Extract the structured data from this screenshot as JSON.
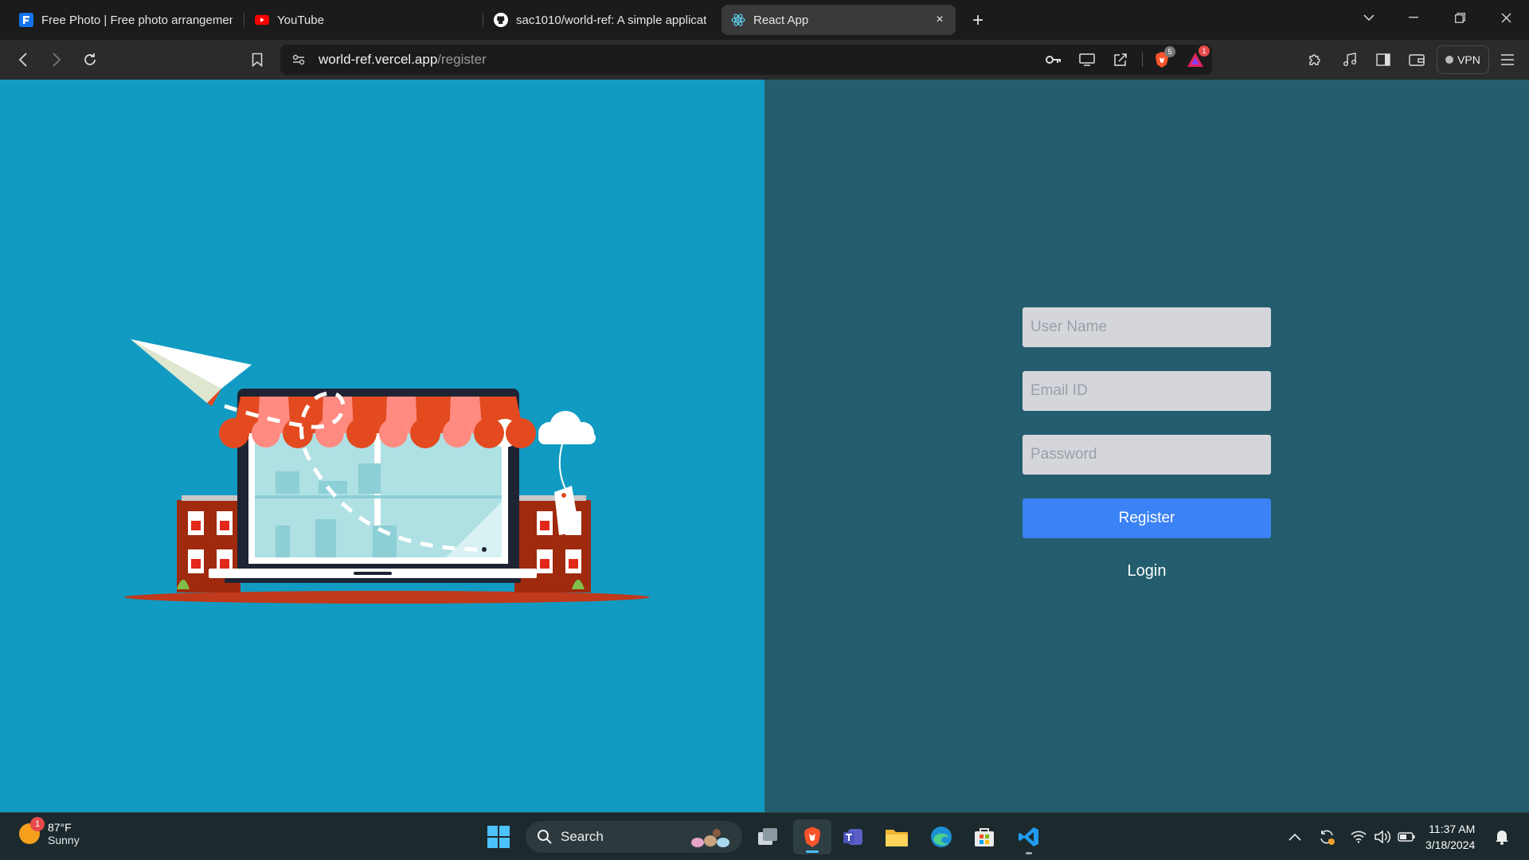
{
  "browser": {
    "tabs": [
      {
        "title": "Free Photo | Free photo arrangemen",
        "favicon": "freepik-icon"
      },
      {
        "title": "YouTube",
        "favicon": "youtube-icon"
      },
      {
        "title": "sac1010/world-ref: A simple applicat",
        "favicon": "github-icon"
      },
      {
        "title": "React App",
        "favicon": "react-icon",
        "active": true
      }
    ],
    "new_tab": "+",
    "url_host": "world-ref.vercel.app",
    "url_path": "/register",
    "brave_shield_count": "5",
    "rewards_count": "1",
    "vpn_label": "VPN",
    "close_tab": "×"
  },
  "form": {
    "username_placeholder": "User Name",
    "email_placeholder": "Email ID",
    "password_placeholder": "Password",
    "register_label": "Register",
    "login_label": "Login"
  },
  "colors": {
    "left_bg": "#129bc2",
    "right_bg": "#235d6e",
    "button": "#3b82f6",
    "field_bg": "#d5d6db"
  },
  "taskbar": {
    "weather_temp": "87°F",
    "weather_desc": "Sunny",
    "weather_badge": "1",
    "search_label": "Search",
    "time": "11:37 AM",
    "date": "3/18/2024"
  }
}
